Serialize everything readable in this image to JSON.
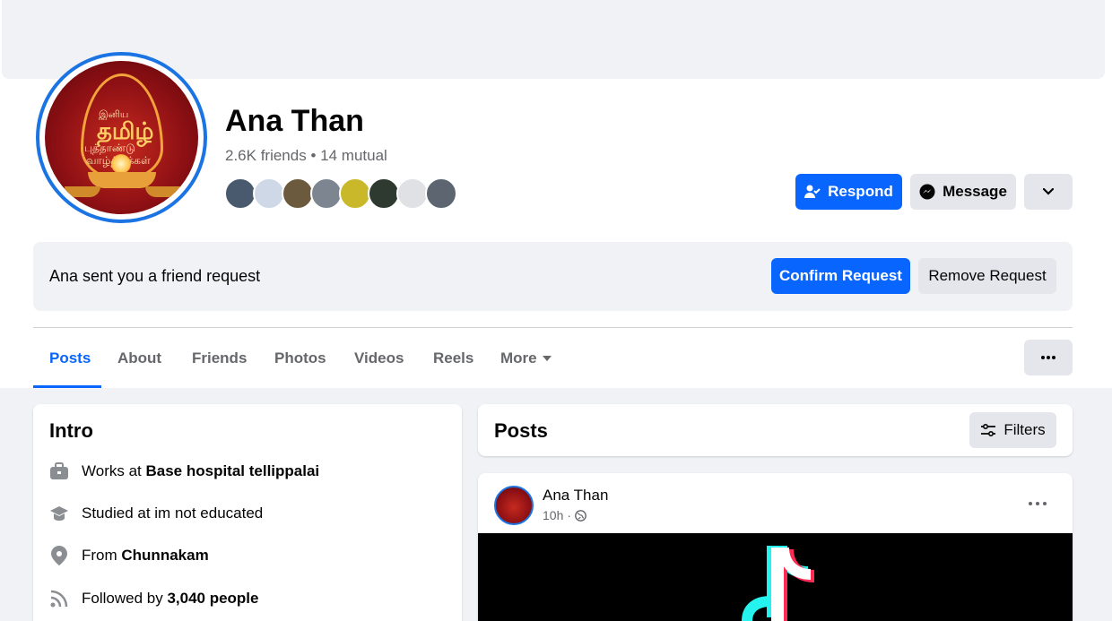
{
  "profile": {
    "name": "Ana Than",
    "friends_count": "2.6K friends",
    "separator": "•",
    "mutual_count": "14 mutual",
    "avatar_text": {
      "line1": "இனிய",
      "line2": "தமிழ்",
      "line3": "புத்தாண்டு",
      "line4": "வாழ்த்துக்கள்"
    }
  },
  "actions": {
    "respond_label": "Respond",
    "message_label": "Message"
  },
  "friend_request": {
    "message": "Ana sent you a friend request",
    "confirm_label": "Confirm Request",
    "remove_label": "Remove Request"
  },
  "tabs": [
    {
      "label": "Posts",
      "active": true
    },
    {
      "label": "About"
    },
    {
      "label": "Friends"
    },
    {
      "label": "Photos"
    },
    {
      "label": "Videos"
    },
    {
      "label": "Reels"
    },
    {
      "label": "More"
    }
  ],
  "intro": {
    "title": "Intro",
    "works_prefix": "Works at ",
    "works_place": "Base hospital tellippalai",
    "studied": "Studied at im not educated",
    "from_prefix": "From ",
    "from_place": "Chunnakam",
    "followed_prefix": "Followed by ",
    "followed_count": "3,040 people"
  },
  "posts_section": {
    "title": "Posts",
    "filters_label": "Filters"
  },
  "post": {
    "author": "Ana Than",
    "time": "10h",
    "time_separator": "·"
  },
  "colors": {
    "accent_blue": "#0866ff",
    "button_grey": "#e4e6eb",
    "page_bg": "#f0f2f5",
    "muted_text": "#65676b"
  }
}
